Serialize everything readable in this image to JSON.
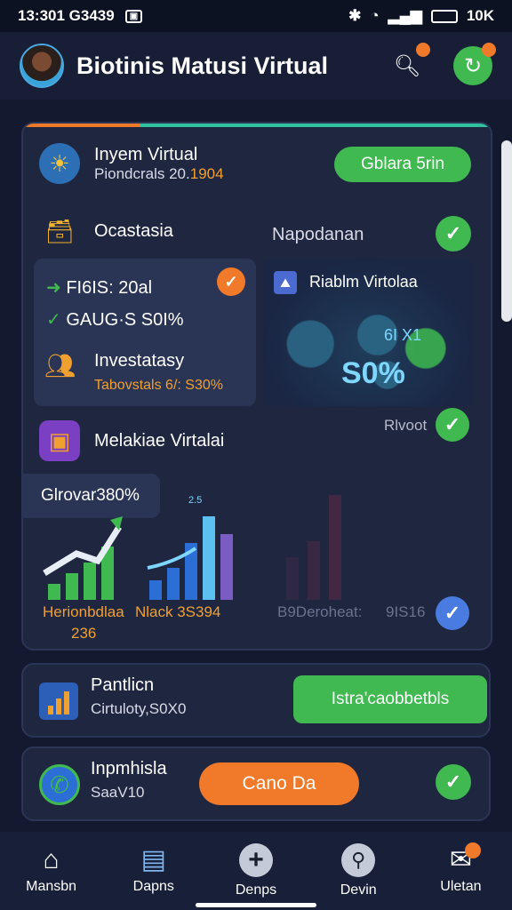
{
  "status": {
    "time": "13:301 G3439",
    "battery": "10K"
  },
  "header": {
    "title": "Biotinis Matusi Virtual"
  },
  "main_card": {
    "item1": {
      "title": "Inyem Virtual",
      "subtitle_a": "Piondcrals 20.",
      "subtitle_b": "1904",
      "button": "Gblara 5rin"
    },
    "item2": {
      "title": "Ocastasia",
      "right_label": "Napodanan"
    },
    "stats": {
      "line1": "FI6IS: 20al",
      "line2": "GAUG·S S0I%",
      "invest_title": "Investatasy",
      "invest_sub": "Tabovstals 6/: S30%"
    },
    "map": {
      "title": "Riablm Virtolaa",
      "value": "S0%",
      "small": "6I X1"
    },
    "item3": {
      "title": "Melakiae Virtalai",
      "right_label": "Rlvoot"
    },
    "growth": {
      "label": "Glrovar380%",
      "left_caption": "Herionbdlaa",
      "left_value": "236",
      "mid_caption": "Nlack 3S394",
      "mid_top": "2.5",
      "right_caption": "B9Deroheat:",
      "right_value": "9IS16"
    }
  },
  "bottom1": {
    "title": "Pantlicn",
    "sub": "Cirtuloty,S0X0",
    "button": "Istra'caobbetbls"
  },
  "bottom2": {
    "title": "Inpmhisla",
    "sub": "SaaV10",
    "button": "Cano Da"
  },
  "nav": [
    {
      "label": "Mansbn",
      "icon": "home-icon"
    },
    {
      "label": "Dapns",
      "icon": "document-icon"
    },
    {
      "label": "Denps",
      "icon": "add-icon"
    },
    {
      "label": "Devin",
      "icon": "search-icon"
    },
    {
      "label": "Uletan",
      "icon": "messages-icon"
    }
  ]
}
